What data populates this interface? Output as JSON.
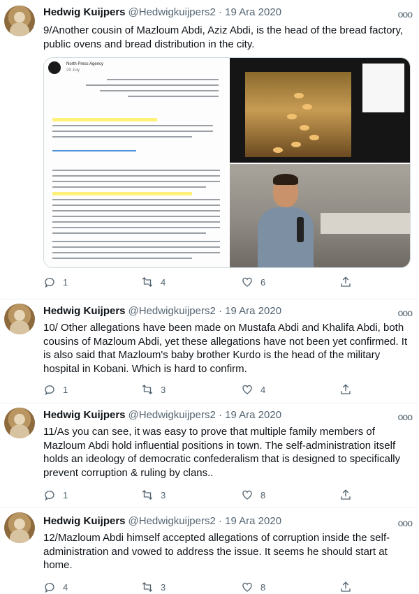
{
  "tweets": [
    {
      "name": "Hedwig Kuijpers",
      "handle": "@Hedwigkuijpers2 · 19 Ara 2020",
      "text": "9/Another cousin of Mazloum Abdi, Aziz Abdi, is the head of the bread factory, public ovens and bread distribution in the city.",
      "replies": "1",
      "retweets": "4",
      "likes": "6",
      "media": {
        "agency": "North Press Agency",
        "date": "29 July"
      }
    },
    {
      "name": "Hedwig Kuijpers",
      "handle": "@Hedwigkuijpers2 · 19 Ara 2020",
      "text": "10/ Other allegations have been made on Mustafa Abdi and Khalifa Abdi, both cousins of Mazloum Abdi, yet these allegations have not been yet confirmed. It is also said that Mazloum's baby brother Kurdo is the head of the military hospital in Kobani. Which is hard to confirm.",
      "replies": "1",
      "retweets": "3",
      "likes": "4"
    },
    {
      "name": "Hedwig Kuijpers",
      "handle": "@Hedwigkuijpers2 · 19 Ara 2020",
      "text": "11/As you can see, it was easy to prove that multiple family members of Mazloum Abdi hold influential positions in town. The self-administration itself holds an ideology of democratic confederalism that is designed to specifically prevent corruption & ruling by clans..",
      "replies": "1",
      "retweets": "3",
      "likes": "8"
    },
    {
      "name": "Hedwig Kuijpers",
      "handle": "@Hedwigkuijpers2 · 19 Ara 2020",
      "text": "12/Mazloum Abdi himself accepted allegations of corruption inside the self-administration and vowed to address the issue. It seems he should start at home.",
      "replies": "4",
      "retweets": "3",
      "likes": "8"
    }
  ],
  "icons": {
    "reply": "reply-icon",
    "retweet": "retweet-icon",
    "like": "heart-icon",
    "share": "share-icon",
    "more": "more-icon"
  },
  "colors": {
    "text": "#0f1419",
    "secondary": "#536471",
    "highlight": "#fff27a"
  }
}
